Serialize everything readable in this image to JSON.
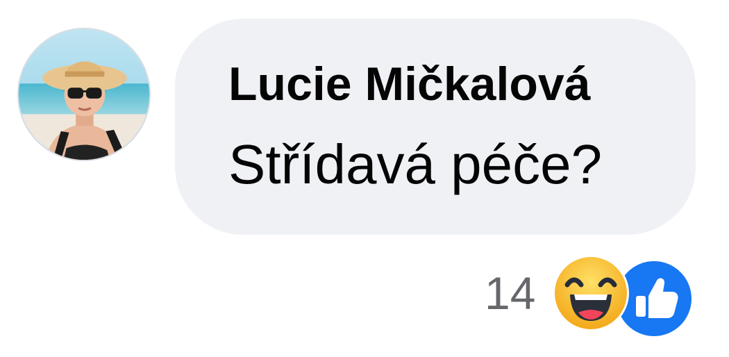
{
  "comment": {
    "author": "Lucie Mičkalová",
    "text": "Střídavá péče?",
    "reactions": {
      "count": "14",
      "types": [
        "haha-icon",
        "like-icon"
      ],
      "colors": {
        "like": "#1877f2",
        "haha": "#f7b928"
      }
    }
  },
  "colors": {
    "bubble_background": "#eff1f5",
    "text": "#050505",
    "secondary_text": "#65676b"
  }
}
